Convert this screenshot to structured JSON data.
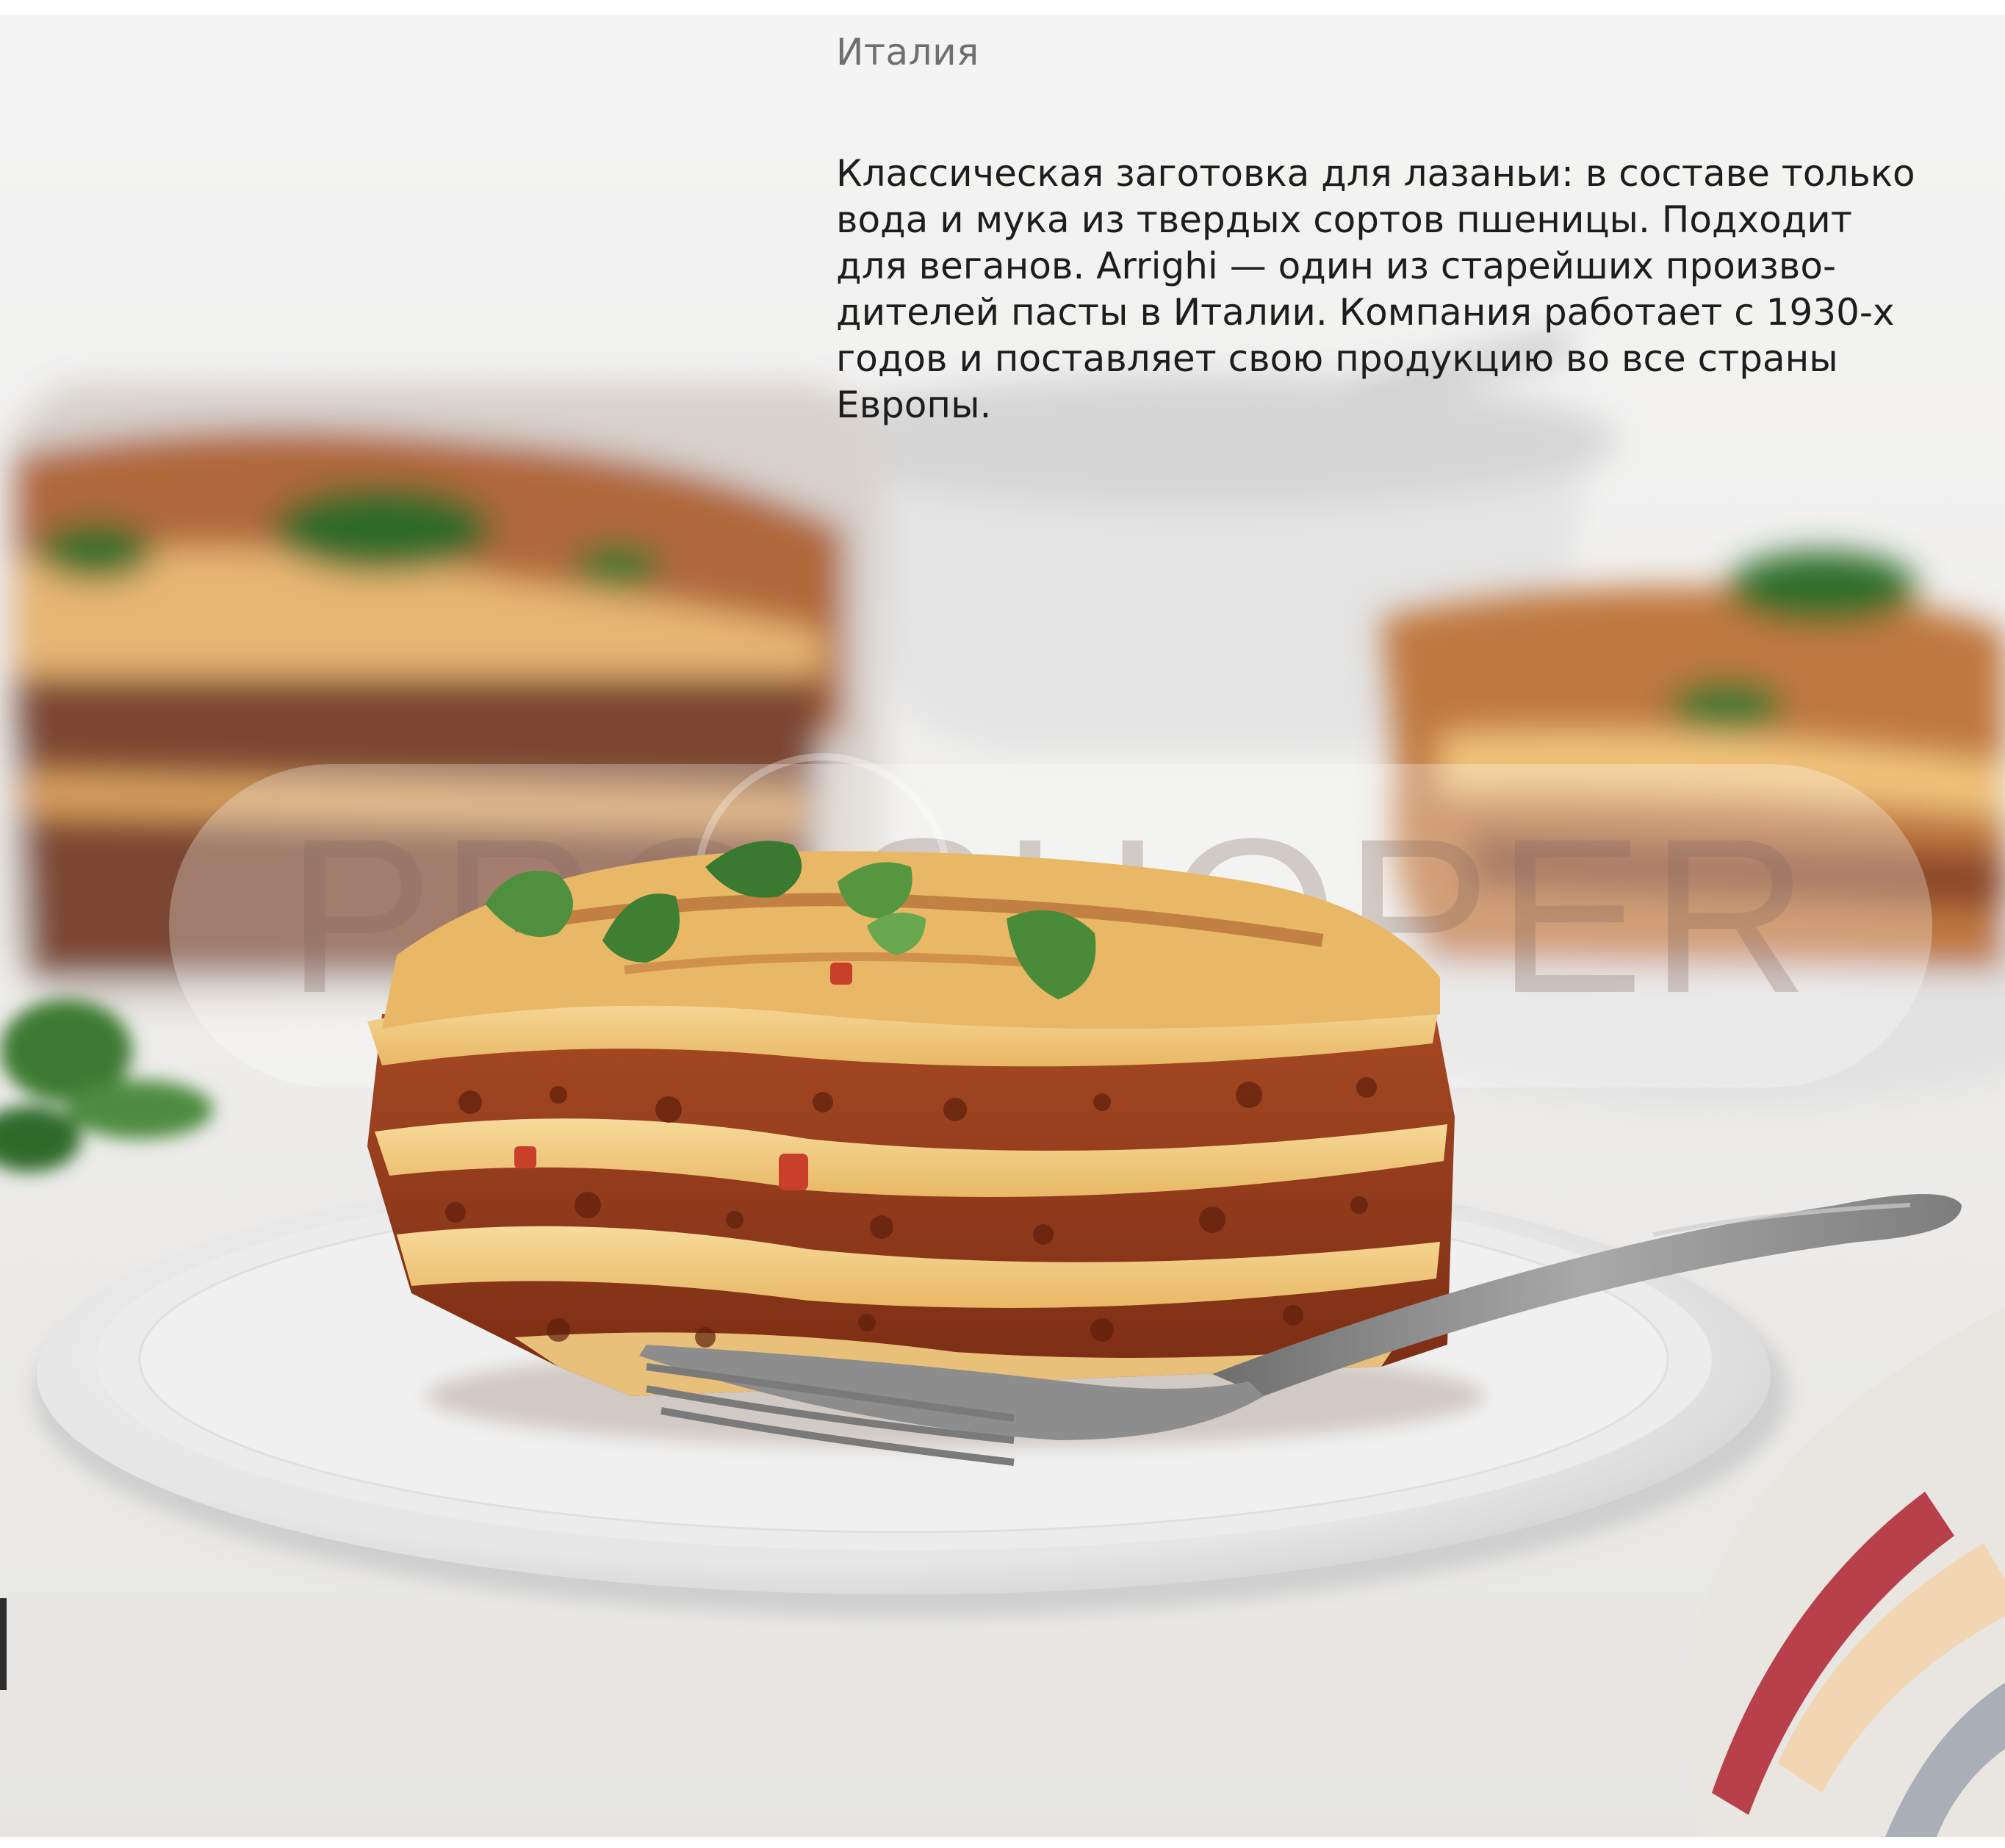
{
  "watermark": {
    "text": "PRO SHOPER"
  },
  "product": {
    "country": "Италия",
    "description_lines": [
      "Классическая заготовка для лазаньи: в составе только",
      "вода и мука из твердых сортов пшеницы. Подходит",
      "для веганов. Arrighi — один из старейших произво-",
      "дителей пасты в Италии. Компания работает с 1930-х",
      "годов и поставляет свою продукцию во все страны",
      "Европы."
    ]
  },
  "colors": {
    "background": "#f2f1f0",
    "watermark_text": "#8a7068",
    "lasagna_sauce": "#8e3a1c",
    "pasta_layer": "#f0c97a"
  }
}
